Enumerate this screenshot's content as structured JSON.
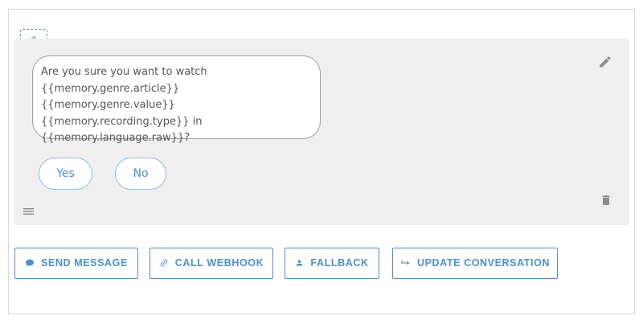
{
  "toolbar": {
    "add_label": "+"
  },
  "message": {
    "text": "Are you sure you want to watch\n{{memory.genre.article}} {{memory.genre.value}}\n{{memory.recording.type}} in\n{{memory.language.raw}}?"
  },
  "quick_replies": [
    {
      "label": "Yes"
    },
    {
      "label": "No"
    }
  ],
  "icons": {
    "edit": "pencil-icon",
    "delete": "trash-icon",
    "drag": "drag-handle-icon"
  },
  "actions": [
    {
      "label": "SEND MESSAGE",
      "icon": "chat-bubble-icon"
    },
    {
      "label": "CALL WEBHOOK",
      "icon": "link-icon"
    },
    {
      "label": "FALLBACK",
      "icon": "person-icon"
    },
    {
      "label": "UPDATE CONVERSATION",
      "icon": "redirect-arrow-icon"
    }
  ],
  "colors": {
    "accent": "#4a90d2",
    "card_background": "#efefef",
    "icon_gray": "#8a8a8a"
  }
}
